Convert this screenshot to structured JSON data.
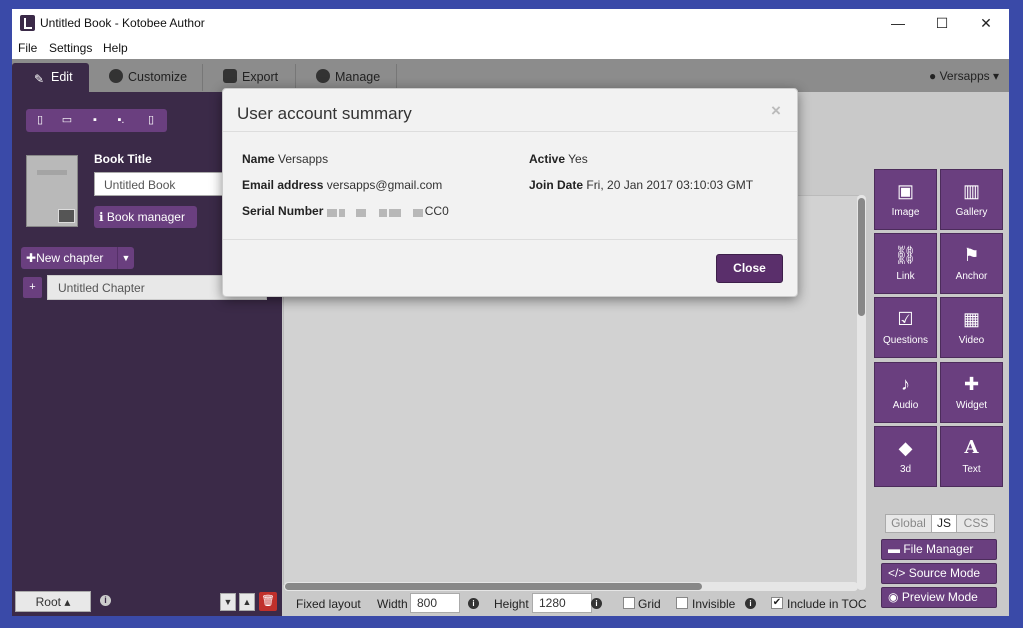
{
  "window": {
    "title": "Untitled Book - Kotobee Author",
    "minimize_glyph": "—",
    "maximize_glyph": "☐",
    "close_glyph": "✕"
  },
  "menu": {
    "items": [
      "File",
      "Settings",
      "Help"
    ]
  },
  "tabs": [
    {
      "label": "Edit",
      "icon": "pencil-icon",
      "active": true
    },
    {
      "label": "Customize",
      "icon": "wrench-icon",
      "active": false
    },
    {
      "label": "Export",
      "icon": "export-icon",
      "active": false
    },
    {
      "label": "Manage",
      "icon": "user-icon",
      "active": false
    }
  ],
  "user_menu": {
    "label": "Versapps",
    "icon": "user-icon"
  },
  "sidebar": {
    "toolbar_icons": [
      "new-file-icon",
      "open-folder-icon",
      "save-icon",
      "save-as-icon",
      "pdf-icon"
    ],
    "book_title_label": "Book Title",
    "book_title_value": "Untitled Book",
    "book_manager_label": "Book manager",
    "new_chapter_label": "New chapter",
    "chapter_plus": "+",
    "chapter_name": "Untitled Chapter",
    "root_label": "Root"
  },
  "bottom_bar": {
    "layout_label": "Fixed layout",
    "width_label": "Width",
    "width_value": "800",
    "height_label": "Height",
    "height_value": "1280",
    "grid_label": "Grid",
    "grid_checked": false,
    "invisible_label": "Invisible",
    "invisible_checked": false,
    "toc_label": "Include in TOC",
    "toc_checked": true
  },
  "widgets": [
    {
      "label": "Image",
      "icon": "image-icon",
      "glyph": "▣"
    },
    {
      "label": "Gallery",
      "icon": "gallery-icon",
      "glyph": "▥"
    },
    {
      "label": "Link",
      "icon": "link-icon",
      "glyph": "⛓"
    },
    {
      "label": "Anchor",
      "icon": "flag-icon",
      "glyph": "⚑"
    },
    {
      "label": "Questions",
      "icon": "checkbox-icon",
      "glyph": "☑"
    },
    {
      "label": "Video",
      "icon": "film-icon",
      "glyph": "▦"
    },
    {
      "label": "Audio",
      "icon": "microphone-icon",
      "glyph": "♪"
    },
    {
      "label": "Widget",
      "icon": "puzzle-icon",
      "glyph": "✚"
    },
    {
      "label": "3d",
      "icon": "cube-icon",
      "glyph": "◆"
    },
    {
      "label": "Text",
      "icon": "text-icon",
      "glyph": "A"
    }
  ],
  "code_tabs": {
    "global": "Global",
    "js": "JS",
    "css": "CSS"
  },
  "side_buttons": {
    "file_manager": "File Manager",
    "source_mode": "Source Mode",
    "preview_mode": "Preview Mode"
  },
  "modal": {
    "title": "User account summary",
    "close_x": "×",
    "name_label": "Name",
    "name_value": "Versapps",
    "email_label": "Email address",
    "email_value": "versapps@gmail.com",
    "serial_label": "Serial Number",
    "serial_suffix": "CC0",
    "active_label": "Active",
    "active_value": "Yes",
    "join_label": "Join Date",
    "join_value": "Fri, 20 Jan 2017 03:10:03 GMT",
    "close_button": "Close"
  },
  "colors": {
    "purple_dark": "#3b2a48",
    "purple_button": "#6a3f7f",
    "desktop_blue": "#3a4aa8",
    "delete_red": "#c0302b"
  }
}
